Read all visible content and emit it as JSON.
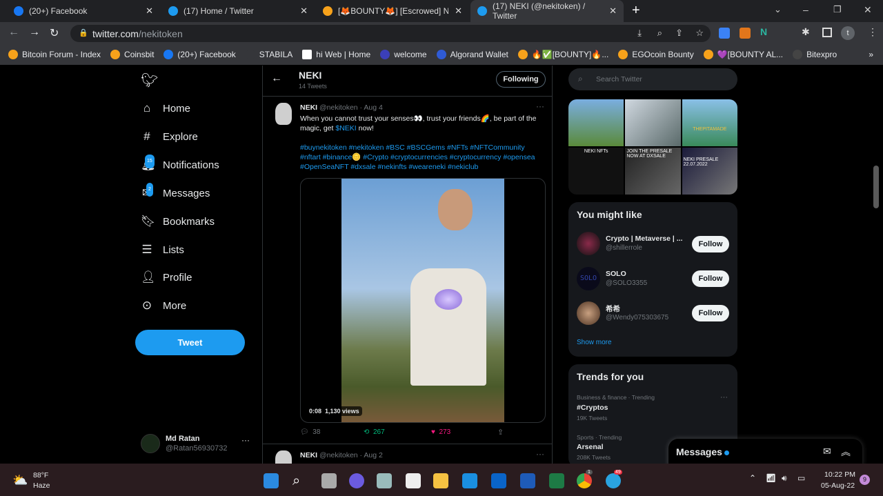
{
  "browser": {
    "tabs": [
      {
        "title": "(20+) Facebook"
      },
      {
        "title": "(17) Home / Twitter"
      },
      {
        "title": "[🦊BOUNTY🦊] [Escrowed] NEKI"
      },
      {
        "title": "(17) NEKI (@nekitoken) / Twitter",
        "active": true
      }
    ],
    "url_host": "twitter.com",
    "url_path": "/nekitoken",
    "profile_initial": "t",
    "bookmarks": [
      "Bitcoin Forum - Index",
      "Coinsbit",
      "(20+) Facebook",
      "STABILA",
      "hi Web | Home",
      "welcome",
      "Algorand Wallet",
      "🔥✅[BOUNTY]🔥...",
      "EGOcoin Bounty",
      "💜[BOUNTY AL...",
      "Bitexpro"
    ],
    "more": "»"
  },
  "sidebar": {
    "items": [
      {
        "label": "Home",
        "icon": "home-icon"
      },
      {
        "label": "Explore",
        "icon": "hash-icon"
      },
      {
        "label": "Notifications",
        "icon": "bell-icon",
        "badge": "15"
      },
      {
        "label": "Messages",
        "icon": "mail-icon",
        "badge": "2"
      },
      {
        "label": "Bookmarks",
        "icon": "bookmark-icon"
      },
      {
        "label": "Lists",
        "icon": "list-icon"
      },
      {
        "label": "Profile",
        "icon": "person-icon"
      },
      {
        "label": "More",
        "icon": "more-circle-icon"
      }
    ],
    "tweet_button": "Tweet",
    "account": {
      "name": "Md Ratan",
      "handle": "@Ratan56930732"
    }
  },
  "header": {
    "name": "NEKI",
    "count": "14 Tweets",
    "following": "Following"
  },
  "tweets": [
    {
      "name": "NEKI",
      "handle": "@nekitoken",
      "date": "· Aug 4",
      "text1": "When you cannot trust your senses👀, trust your friends🌈, be part of the magic, get ",
      "cashtag": "$NEKI",
      "text2": " now!",
      "hashtags": "#buynekitoken #nekitoken #BSC #BSCGems #NFTs #NFTCommunity #nftart #binance🪙 #Crypto #cryptocurrencies #cryptocurrency #opensea #OpenSeaNFT #dxsale #nekinfts #weareneki #nekiclub",
      "video_time": "0:08",
      "views": "1,130 views",
      "replies": "38",
      "retweets": "267",
      "likes": "273"
    },
    {
      "name": "NEKI",
      "handle": "@nekitoken",
      "date": "· Aug 2"
    }
  ],
  "search": {
    "placeholder": "Search Twitter"
  },
  "who_to_follow": {
    "title": "You might like",
    "users": [
      {
        "name": "Crypto | Metaverse | ...",
        "handle": "@shillerrole"
      },
      {
        "name": "SOLO",
        "handle": "@SOLO3355",
        "avatar_text": "SOLO"
      },
      {
        "name": "希希",
        "handle": "@Wendy075303675"
      }
    ],
    "follow": "Follow",
    "show_more": "Show more"
  },
  "media_grid": {
    "tiles": [
      "",
      "",
      "THEPITAMADE",
      "JOIN THE PRESALE NOW AT DXSALE",
      "NEKI NFTs",
      "NEKI PRESALE 22.07.2022"
    ]
  },
  "trends": {
    "title": "Trends for you",
    "items": [
      {
        "context": "Business & finance · Trending",
        "name": "#Cryptos",
        "count": "19K Tweets"
      },
      {
        "context": "Sports · Trending",
        "name": "Arsenal",
        "count": "208K Tweets"
      }
    ]
  },
  "messages_drawer": {
    "title": "Messages"
  },
  "taskbar": {
    "temp": "88°F",
    "weather": "Haze",
    "time": "10:22 PM",
    "date": "05-Aug-22",
    "notif": "9",
    "chrome_badge": "1",
    "telegram_badge": "49"
  },
  "colors": {
    "accent": "#1d9bf0",
    "like": "#f91880",
    "retweet": "#00ba7c"
  }
}
